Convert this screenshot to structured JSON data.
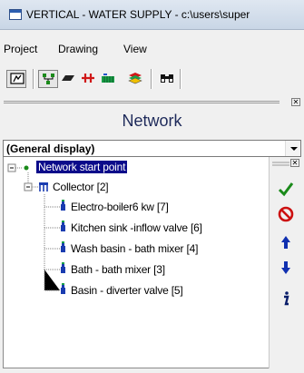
{
  "window": {
    "title": "VERTICAL - WATER SUPPLY - c:\\users\\super"
  },
  "menu": {
    "items": [
      "Project",
      "Drawing",
      "View"
    ]
  },
  "toolbar": {
    "buttons": [
      "display-icon",
      "tree-network-icon",
      "parallelogram-icon",
      "pipe-fitting-icon",
      "radiator-icon",
      "layers-icon",
      "binoculars-icon"
    ]
  },
  "panel": {
    "title": "Network"
  },
  "display_select": {
    "value": "(General display)"
  },
  "tree": {
    "root": "Network start point",
    "collector": "Collector [2]",
    "children": [
      "Electro-boiler6  kw [7]",
      "Kitchen sink -inflow valve [6]",
      "Wash basin - bath mixer [4]",
      "Bath - bath mixer [3]",
      "Basin - diverter valve [5]"
    ]
  },
  "side_buttons": [
    "confirm-check-icon",
    "delete-forbidden-icon",
    "move-up-icon",
    "move-down-icon",
    "info-icon"
  ],
  "colors": {
    "selection": "#0a0a8a",
    "panel_title": "#1e2a5a",
    "check": "#1a8a1a",
    "stop": "#cc1010",
    "arrow": "#1030b0",
    "node_icon": "#1a3cb0"
  }
}
